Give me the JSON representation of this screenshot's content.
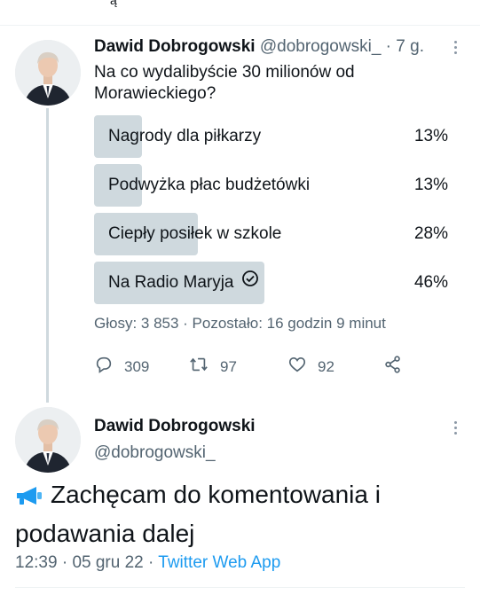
{
  "top": {
    "glyph": "ą"
  },
  "tweet1": {
    "author_name": "Dawid Dobrogowski",
    "author_handle": "@dobrogowski_",
    "separator": "·",
    "time": "7 g.",
    "text": "Na co wydalibyście 30 milionów od Morawieckiego?",
    "poll": {
      "options": [
        {
          "label": "Nagrody dla piłkarzy",
          "percent": "13%",
          "fraction": 0.13,
          "selected": false
        },
        {
          "label": "Podwyżka płac budżetówki",
          "percent": "13%",
          "fraction": 0.13,
          "selected": false
        },
        {
          "label": "Ciepły posiłek w szkole",
          "percent": "28%",
          "fraction": 0.28,
          "selected": false
        },
        {
          "label": "Na Radio Maryja",
          "percent": "46%",
          "fraction": 0.46,
          "selected": true
        }
      ],
      "meta": "Głosy: 3 853 · Pozostało: 16 godzin 9 minut"
    },
    "actions": {
      "replies": "309",
      "retweets": "97",
      "likes": "92"
    }
  },
  "tweet2": {
    "author_name": "Dawid Dobrogowski",
    "author_handle": "@dobrogowski_",
    "text": "Zachęcam do komentowania i podawania dalej",
    "time": "12:39",
    "separator1": "·",
    "date": "05 gru 22",
    "separator2": "·",
    "app": "Twitter Web App"
  },
  "colors": {
    "accent": "#1d9bf0",
    "secondary_text": "#536471",
    "poll_bar": "#cfd9de",
    "primary_text": "#0f1419"
  },
  "icons": [
    "more-icon",
    "reply-icon",
    "retweet-icon",
    "like-icon",
    "share-icon",
    "check-icon",
    "megaphone-icon"
  ]
}
